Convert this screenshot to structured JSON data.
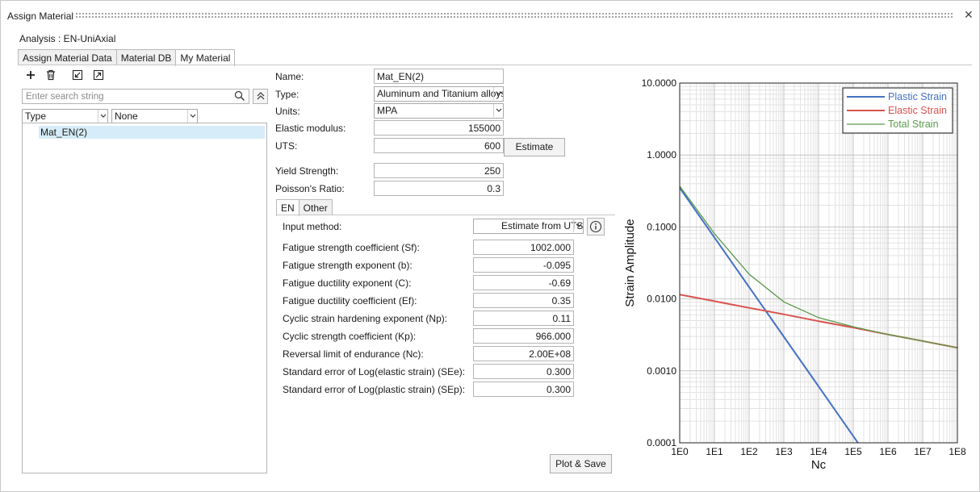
{
  "window": {
    "title": "Assign Material"
  },
  "analysis": "Analysis : EN-UniAxial",
  "tabs": [
    {
      "label": "Assign Material Data"
    },
    {
      "label": "Material DB"
    },
    {
      "label": "My Material"
    }
  ],
  "left": {
    "search_placeholder": "Enter search string",
    "filter_type": "Type",
    "filter_value": "None",
    "items": [
      {
        "label": "Mat_EN(2)"
      }
    ]
  },
  "form": {
    "name_label": "Name:",
    "name_value": "Mat_EN(2)",
    "type_label": "Type:",
    "type_value": "Aluminum and Titanium alloys",
    "units_label": "Units:",
    "units_value": "MPA",
    "elastic_label": "Elastic modulus:",
    "elastic_value": "155000",
    "uts_label": "UTS:",
    "uts_value": "600",
    "estimate_label": "Estimate",
    "yield_label": "Yield Strength:",
    "yield_value": "250",
    "poisson_label": "Poisson's Ratio:",
    "poisson_value": "0.3"
  },
  "subtabs": [
    {
      "label": "EN"
    },
    {
      "label": "Other"
    }
  ],
  "en": {
    "input_method_label": "Input method:",
    "input_method_value": "Estimate from UTS",
    "params": [
      {
        "label": "Fatigue strength coefficient (Sf):",
        "value": "1002.000"
      },
      {
        "label": "Fatigue strength exponent (b):",
        "value": "-0.095"
      },
      {
        "label": "Fatigue ductility exponent (C):",
        "value": "-0.69"
      },
      {
        "label": "Fatigue ductility coefficient (Ef):",
        "value": "0.35"
      },
      {
        "label": "Cyclic strain hardening exponent (Np):",
        "value": "0.11"
      },
      {
        "label": "Cyclic strength coefficient (Kp):",
        "value": "966.000"
      },
      {
        "label": "Reversal limit of endurance (Nc):",
        "value": "2.00E+08"
      },
      {
        "label": "Standard error of Log(elastic strain) (SEe):",
        "value": "0.300"
      },
      {
        "label": "Standard error of Log(plastic strain) (SEp):",
        "value": "0.300"
      }
    ],
    "plot_save_label": "Plot & Save"
  },
  "chart_data": {
    "type": "line",
    "xscale": "log",
    "yscale": "log",
    "xlim": [
      1,
      100000000
    ],
    "ylim": [
      0.0001,
      10
    ],
    "xlabel": "Nc",
    "ylabel": "Strain Amplitude",
    "xticks": [
      "1E0",
      "1E1",
      "1E2",
      "1E3",
      "1E4",
      "1E5",
      "1E6",
      "1E7",
      "1E8"
    ],
    "yticks": [
      "0.0001",
      "0.0010",
      "0.0100",
      "0.1000",
      "1.0000",
      "10.0000"
    ],
    "grid": true,
    "legend": "top-right",
    "series": [
      {
        "name": "Plastic Strain",
        "color": "#4472c4",
        "x": [
          1,
          10,
          100,
          1000,
          10000,
          100000,
          140000
        ],
        "y": [
          0.35,
          0.0715,
          0.0146,
          0.00298,
          0.000609,
          0.000124,
          9.8e-05
        ]
      },
      {
        "name": "Elastic Strain",
        "color": "#d9534f",
        "x": [
          1,
          10,
          100,
          1000,
          10000,
          100000,
          1000000,
          10000000,
          100000000
        ],
        "y": [
          0.0115,
          0.0093,
          0.0075,
          0.0061,
          0.0049,
          0.004,
          0.0032,
          0.0026,
          0.0021
        ]
      },
      {
        "name": "Total Strain",
        "color": "#5a9a4a",
        "x": [
          1,
          10,
          100,
          1000,
          10000,
          100000,
          1000000,
          10000000,
          100000000
        ],
        "y": [
          0.37,
          0.081,
          0.0221,
          0.0091,
          0.0055,
          0.0041,
          0.0032,
          0.0026,
          0.0021
        ]
      }
    ]
  }
}
